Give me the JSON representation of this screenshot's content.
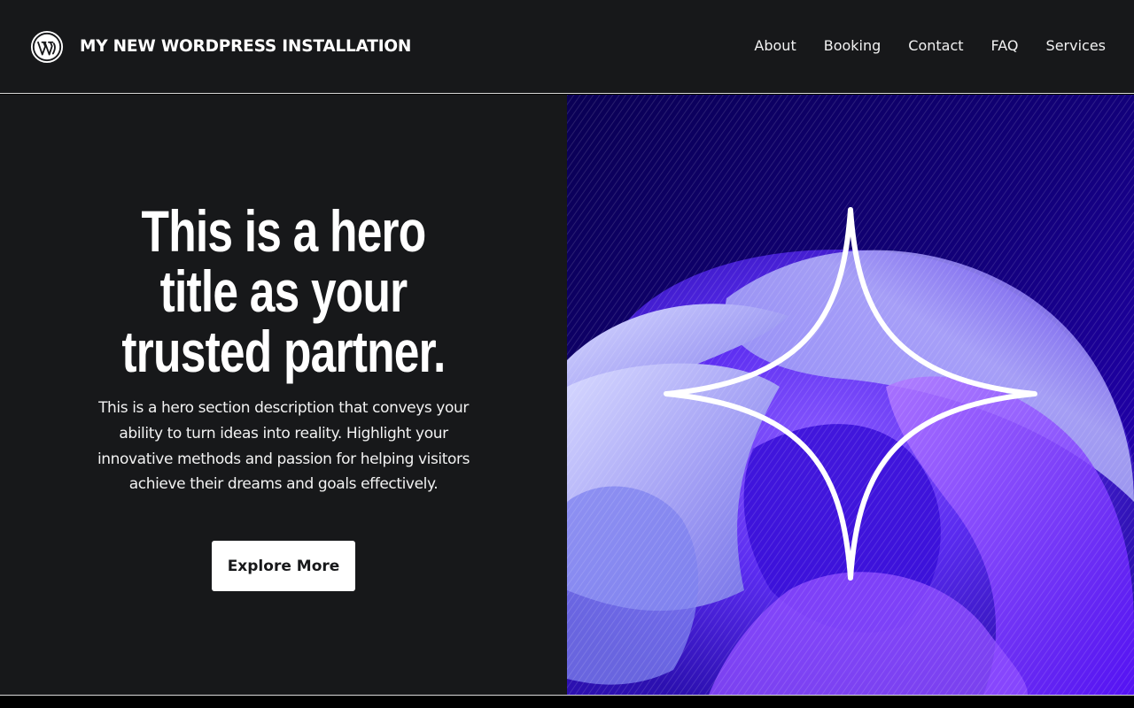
{
  "header": {
    "logo_icon": "wordpress-logo-icon",
    "site_title": "MY NEW WORDPRESS INSTALLATION",
    "nav": [
      {
        "label": "About"
      },
      {
        "label": "Booking"
      },
      {
        "label": "Contact"
      },
      {
        "label": "FAQ"
      },
      {
        "label": "Services"
      }
    ]
  },
  "hero": {
    "title": "This is a hero title as your trusted partner.",
    "description": "This is a hero section description that conveys your ability to turn ideas into reality. Highlight your innovative methods and passion for helping visitors achieve their dreams and goals effectively.",
    "button_label": "Explore More",
    "image_icon": "sparkle-star-icon"
  },
  "colors": {
    "background": "#17181a",
    "text": "#ffffff",
    "button_bg": "#ffffff",
    "button_text": "#17181a",
    "image_deep": "#0d0060",
    "image_violet": "#6a1fff",
    "image_lavender": "#a7a8f0"
  }
}
